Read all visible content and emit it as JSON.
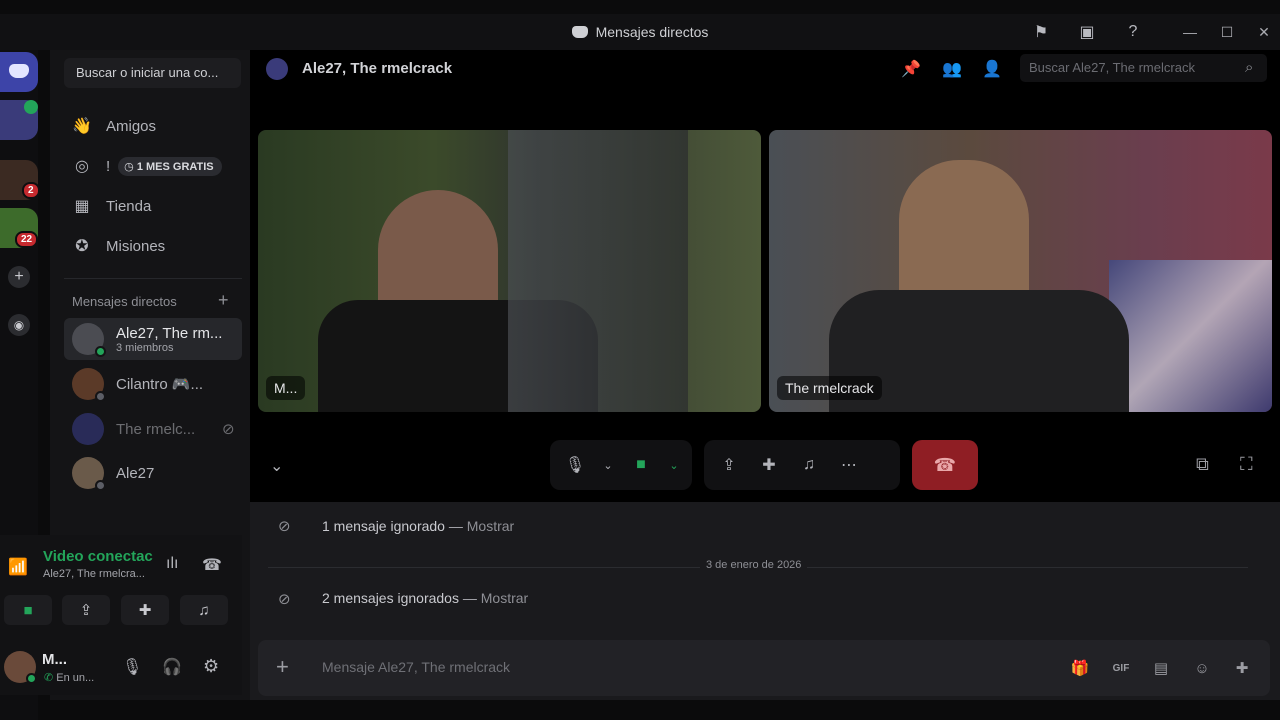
{
  "window": {
    "title": "Mensajes directos",
    "controls": [
      "—",
      "☐",
      "✕"
    ]
  },
  "rail": {
    "badges": [
      "2",
      "22"
    ]
  },
  "sidebar": {
    "search_label": "Buscar o iniciar una co...",
    "nav": [
      {
        "label": "Amigos",
        "icon": "friends-icon"
      },
      {
        "label": "!",
        "icon": "nitro-icon",
        "promo": "1 MES GRATIS"
      },
      {
        "label": "Tienda",
        "icon": "shop-icon"
      },
      {
        "label": "Misiones",
        "icon": "quests-icon"
      }
    ],
    "section_title": "Mensajes directos",
    "dms": [
      {
        "name": "Ale27, The rm...",
        "sub": "3 miembros"
      },
      {
        "name": "Cilantro 🎮...",
        "sub": ""
      },
      {
        "name": "The rmelc...",
        "sub": ""
      },
      {
        "name": "Ale27",
        "sub": ""
      }
    ]
  },
  "voice": {
    "status": "Video conectac",
    "channel": "Ale27, The rmelcra..."
  },
  "user": {
    "name": "M...",
    "status": "En un..."
  },
  "main": {
    "title": "Ale27, The rmelcrack",
    "search_placeholder": "Buscar Ale27, The rmelcrack",
    "tiles": [
      {
        "label": "M..."
      },
      {
        "label": "The rmelcrack"
      }
    ]
  },
  "chat": {
    "ignored1": {
      "text": "1 mensaje ignorado",
      "sep": " — ",
      "action": "Mostrar"
    },
    "date": "3 de enero de 2026",
    "ignored2": {
      "text": "2 mensajes ignorados",
      "sep": " — ",
      "action": "Mostrar"
    },
    "composer_placeholder": "Mensaje Ale27, The rmelcrack"
  },
  "colors": {
    "accent": "#5865f2",
    "voice_green": "#23a55a",
    "danger": "#8f1e24"
  }
}
